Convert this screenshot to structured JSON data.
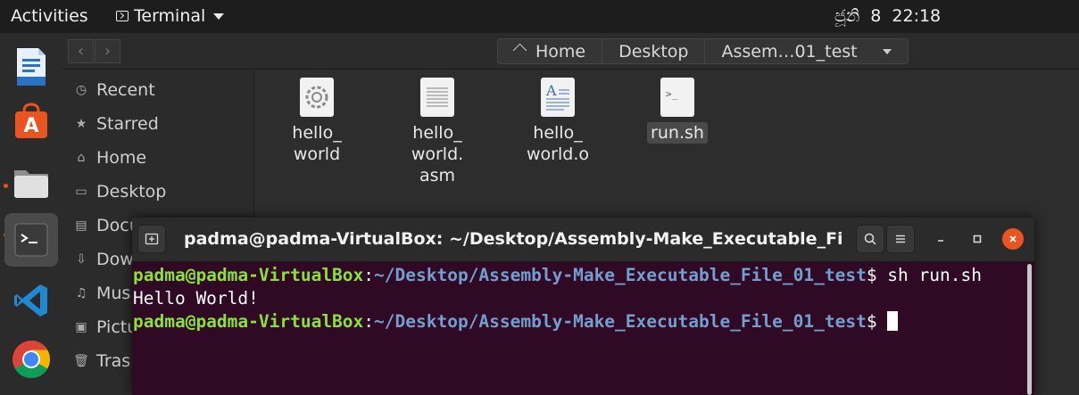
{
  "topbar": {
    "activities": "Activities",
    "app_name": "Terminal",
    "date_day": "ජූනි",
    "date_num": "8",
    "time": "22:18"
  },
  "dock": {
    "items": [
      "LibreOffice Writer",
      "Ubuntu Software",
      "Files",
      "Terminal",
      "Visual Studio Code",
      "Google Chrome"
    ]
  },
  "filemanager": {
    "nav_back": "‹",
    "nav_forward": "›",
    "path": [
      "Home",
      "Desktop",
      "Assem…01_test"
    ],
    "sidebar": [
      "Recent",
      "Starred",
      "Home",
      "Desktop",
      "Docu",
      "Dow",
      "Mus",
      "Pictu",
      "Tras"
    ],
    "files": [
      {
        "name": "hello_\nworld"
      },
      {
        "name": "hello_\nworld.\nasm"
      },
      {
        "name": "hello_\nworld.o"
      },
      {
        "name": "run.sh"
      }
    ]
  },
  "terminal": {
    "title": "padma@padma-VirtualBox: ~/Desktop/Assembly-Make_Executable_File_…",
    "lines": [
      {
        "user": "padma@padma-VirtualBox",
        "sep": ":",
        "path": "~/Desktop/Assembly-Make_Executable_File_01_test",
        "prompt": "$ ",
        "cmd": "sh run.sh"
      },
      {
        "output": "Hello World!"
      },
      {
        "user": "padma@padma-VirtualBox",
        "sep": ":",
        "path": "~/Desktop/Assembly-Make_Executable_File_01_test",
        "prompt": "$ ",
        "cmd": ""
      }
    ]
  },
  "colors": {
    "accent": "#e95420",
    "terminal_bg": "#300a24",
    "prompt_user": "#8ae234",
    "prompt_path": "#729fcf"
  }
}
